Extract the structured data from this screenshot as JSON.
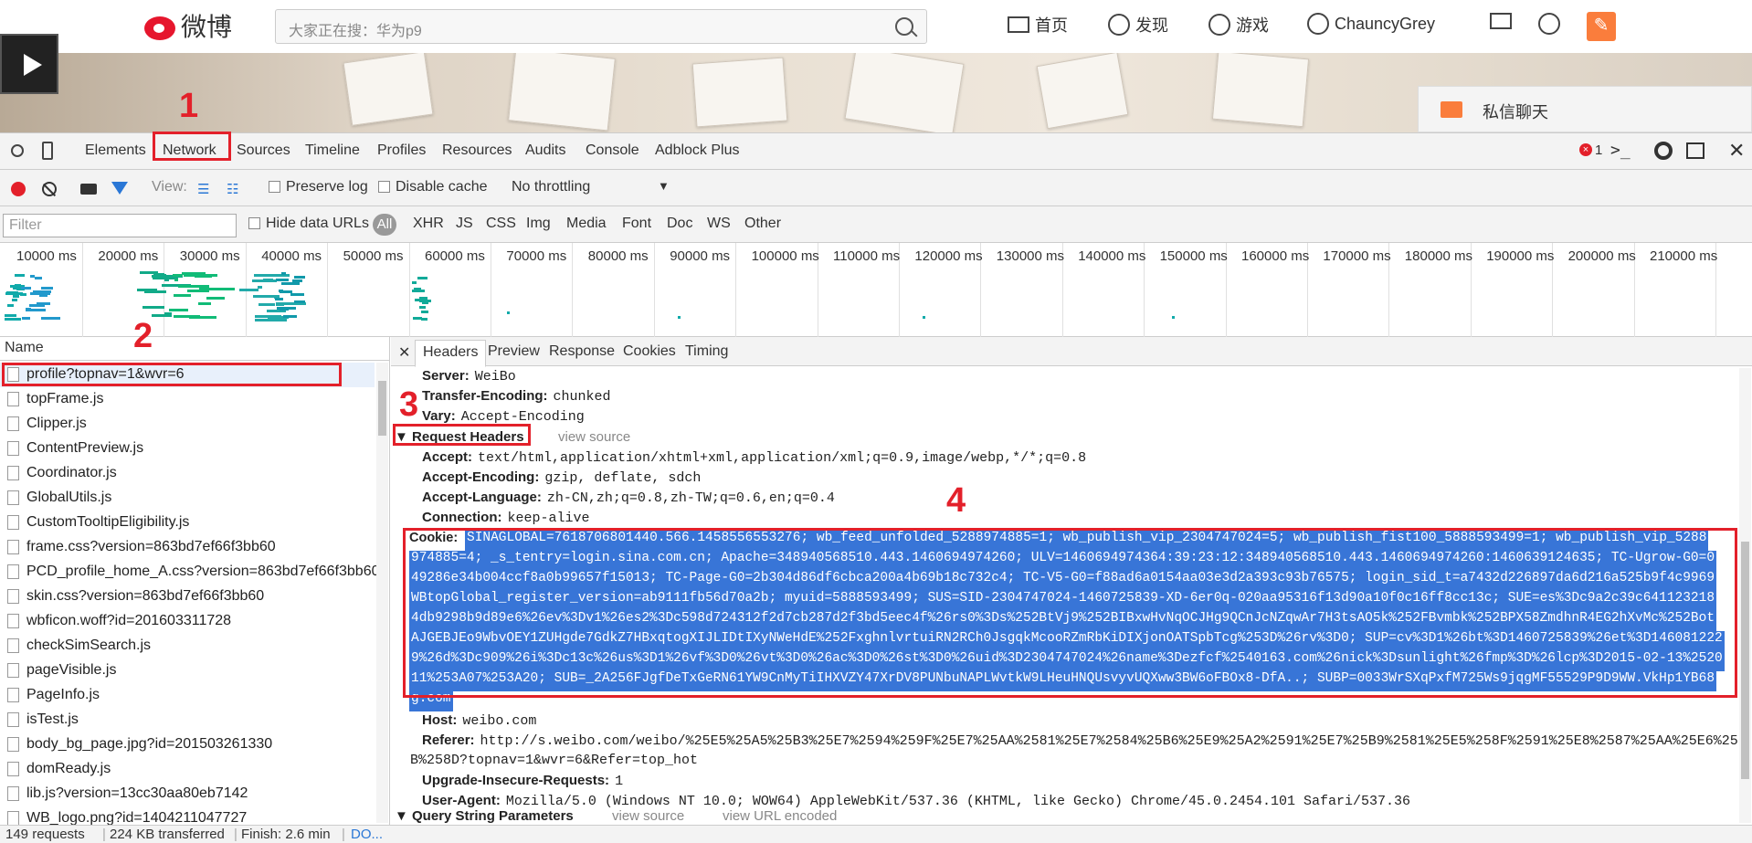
{
  "weibo": {
    "logo_text": "微博",
    "search_placeholder": "大家正在搜：华为p9",
    "nav": {
      "home": "首页",
      "discover": "发现",
      "games": "游戏",
      "user": "ChauncyGrey"
    },
    "private_chat": "私信聊天"
  },
  "annotations": [
    "1",
    "2",
    "3",
    "4"
  ],
  "devtools": {
    "panels": [
      "Elements",
      "Network",
      "Sources",
      "Timeline",
      "Profiles",
      "Resources",
      "Audits",
      "Console",
      "Adblock Plus"
    ],
    "error_count": "1",
    "toolbar": {
      "view_label": "View:",
      "preserve_log": "Preserve log",
      "disable_cache": "Disable cache",
      "throttling": "No throttling"
    },
    "filter": {
      "placeholder": "Filter",
      "hide_data_urls": "Hide data URLs",
      "types": [
        "All",
        "XHR",
        "JS",
        "CSS",
        "Img",
        "Media",
        "Font",
        "Doc",
        "WS",
        "Other"
      ]
    },
    "timeline_ticks": [
      "10000 ms",
      "20000 ms",
      "30000 ms",
      "40000 ms",
      "50000 ms",
      "60000 ms",
      "70000 ms",
      "80000 ms",
      "90000 ms",
      "100000 ms",
      "110000 ms",
      "120000 ms",
      "130000 ms",
      "140000 ms",
      "150000 ms",
      "160000 ms",
      "170000 ms",
      "180000 ms",
      "190000 ms",
      "200000 ms",
      "210000 ms",
      "22"
    ],
    "name_header": "Name",
    "files": [
      "profile?topnav=1&wvr=6",
      "topFrame.js",
      "Clipper.js",
      "ContentPreview.js",
      "Coordinator.js",
      "GlobalUtils.js",
      "CustomTooltipEligibility.js",
      "frame.css?version=863bd7ef66f3bb60",
      "PCD_profile_home_A.css?version=863bd7ef66f3bb60",
      "skin.css?version=863bd7ef66f3bb60",
      "wbficon.woff?id=201603311728",
      "checkSimSearch.js",
      "pageVisible.js",
      "PageInfo.js",
      "isTest.js",
      "body_bg_page.jpg?id=201503261330",
      "domReady.js",
      "lib.js?version=13cc30aa80eb7142",
      "WB_logo.png?id=1404211047727"
    ],
    "detail_tabs": [
      "Headers",
      "Preview",
      "Response",
      "Cookies",
      "Timing"
    ],
    "response_headers": [
      {
        "k": "Server:",
        "v": "WeiBo"
      },
      {
        "k": "Transfer-Encoding:",
        "v": "chunked"
      },
      {
        "k": "Vary:",
        "v": "Accept-Encoding"
      }
    ],
    "request_headers_title": "Request Headers",
    "view_source": "view source",
    "request_headers": [
      {
        "k": "Accept:",
        "v": "text/html,application/xhtml+xml,application/xml;q=0.9,image/webp,*/*;q=0.8"
      },
      {
        "k": "Accept-Encoding:",
        "v": "gzip, deflate, sdch"
      },
      {
        "k": "Accept-Language:",
        "v": "zh-CN,zh;q=0.8,zh-TW;q=0.6,en;q=0.4"
      },
      {
        "k": "Connection:",
        "v": "keep-alive"
      }
    ],
    "cookie_key": "Cookie:",
    "cookie_lines": [
      "SINAGLOBAL=7618706801440.566.1458556553276; wb_feed_unfolded_5288974885=1; wb_publish_vip_2304747024=5; wb_publish_fist100_5888593499=1; wb_publish_vip_5288",
      "974885=4; _s_tentry=login.sina.com.cn; Apache=348940568510.443.1460694974260; ULV=1460694974364:39:23:12:348940568510.443.1460694974260:1460639124635; TC-Ugrow-G0=0",
      "49286e34b004ccf8a0b99657f15013; TC-Page-G0=2b304d86df6cbca200a4b69b18c732c4; TC-V5-G0=f88ad6a0154aa03e3d2a393c93b76575; login_sid_t=a7432d226897da6d216a525b9f4c9969",
      "WBtopGlobal_register_version=ab9111fb56d70a2b; myuid=5888593499; SUS=SID-2304747024-1460725839-XD-6er0q-020aa95316f13d90a10f0c16ff8cc13c; SUE=es%3Dc9a2c39c641123218",
      "4db9298b9d89e6%26ev%3Dv1%26es2%3Dc598d724312f2d7cb287d2f3bd5eec4f%26rs0%3Ds%252BtVj9%252BIBxwHvNqOCJHg9QCnJcNZqwAr7H3tsAO5k%252FBvmbk%252BPX58ZmdhnR4EG2hXvMc%252Bot",
      "AJGEBJEo9WbvOEY1ZUHgde7GdkZ7HBxqtogXIJLIDtIXyNWeHdE%252FxghnlvrtuiRN2RCh0JsgqkMcooRZmRbKiDIXjonOATSpbTcg%253D%26rv%3D0; SUP=cv%3D1%26bt%3D1460725839%26et%3D146081222",
      "9%26d%3Dc909%26i%3Dc13c%26us%3D1%26vf%3D0%26vt%3D0%26ac%3D0%26st%3D0%26uid%3D2304747024%26name%3Dezfcf%2540163.com%26nick%3Dsunlight%26fmp%3D%26lcp%3D2015-02-13%2520",
      "11%253A07%253A20; SUB=_2A256FJgfDeTxGeRN61YW9CnMyTiIHXVZY47XrDV8PUNbuNAPLWvtkW9LHeuHNQUsvyvUQXww3BW6oFBOx8-DfA..; SUBP=0033WrSXqPxfM725Ws9jqgMF55529P9D9WW.VkHp1YB68",
      "g.com"
    ],
    "more_headers": [
      {
        "k": "Host:",
        "v": "weibo.com"
      },
      {
        "k": "Referer:",
        "v": "http://s.weibo.com/weibo/%25E5%25A5%25B3%25E7%2594%259F%25E7%25AA%2581%25E7%2584%25B6%25E9%25A2%2591%25E7%25B9%2581%25E5%258F%2591%25E8%2587%25AA%25E6%258"
      },
      {
        "k": "",
        "v": "B%258D?topnav=1&wvr=6&Refer=top_hot"
      },
      {
        "k": "Upgrade-Insecure-Requests:",
        "v": "1"
      },
      {
        "k": "User-Agent:",
        "v": "Mozilla/5.0 (Windows NT 10.0; WOW64) AppleWebKit/537.36 (KHTML, like Gecko) Chrome/45.0.2454.101 Safari/537.36"
      }
    ],
    "query_title": "Query String Parameters",
    "view_url_encoded": "view URL encoded",
    "status": {
      "requests": "149 requests",
      "transferred": "224 KB transferred",
      "finish": "Finish: 2.6 min",
      "dom": "DO..."
    }
  }
}
